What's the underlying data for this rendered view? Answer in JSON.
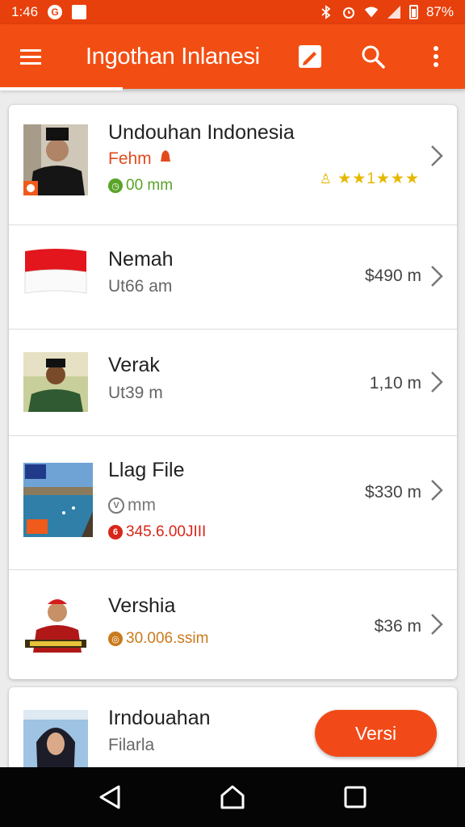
{
  "status_bar": {
    "time": "1:46",
    "battery": "87%"
  },
  "app_bar": {
    "title": "Ingothan Inlanesi",
    "icons": [
      "menu-icon",
      "edit-icon",
      "search-icon",
      "more-vert-icon"
    ]
  },
  "list": [
    {
      "title": "Undouhan Indonesia",
      "subtitle": "Fehm",
      "meta": "00 mm",
      "rating_text": "★★1★★★"
    },
    {
      "title": "Nemah",
      "subtitle": "Ut66 am",
      "price": "$490 m"
    },
    {
      "title": "Verak",
      "subtitle": "Ut39 m",
      "price": "1,10 m"
    },
    {
      "title": "Llag File",
      "subtitle": "mm",
      "meta": "345.6.00JIII",
      "price": "$330 m"
    },
    {
      "title": "Vershia",
      "meta": "30.006.ssim",
      "price": "$36 m"
    }
  ],
  "bottom_card": {
    "title": "Irndouahan",
    "subtitle": "Filarla",
    "button_label": "Versi"
  },
  "colors": {
    "primary": "#f24e13",
    "status_bar": "#e8400c",
    "accent_green": "#5aa428",
    "star_yellow": "#e5b800",
    "red_text": "#d8261a",
    "orange_meta": "#c97a1c"
  }
}
